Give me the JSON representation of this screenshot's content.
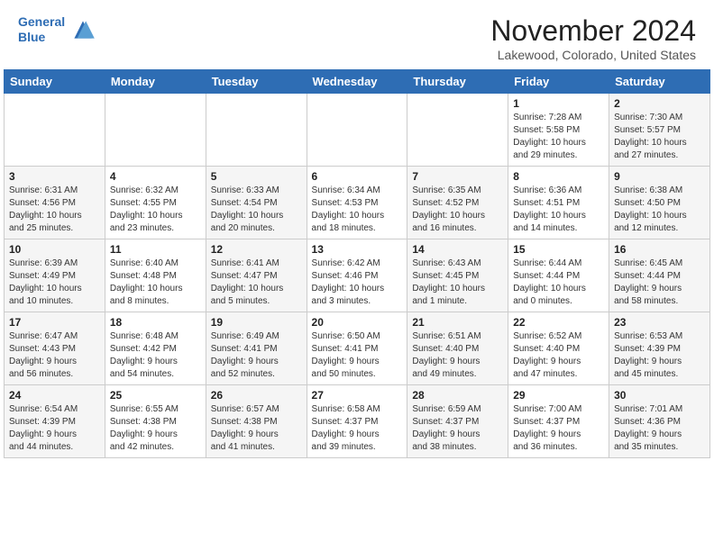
{
  "header": {
    "logo_line1": "General",
    "logo_line2": "Blue",
    "month": "November 2024",
    "location": "Lakewood, Colorado, United States"
  },
  "days_of_week": [
    "Sunday",
    "Monday",
    "Tuesday",
    "Wednesday",
    "Thursday",
    "Friday",
    "Saturday"
  ],
  "weeks": [
    [
      {
        "day": "",
        "info": ""
      },
      {
        "day": "",
        "info": ""
      },
      {
        "day": "",
        "info": ""
      },
      {
        "day": "",
        "info": ""
      },
      {
        "day": "",
        "info": ""
      },
      {
        "day": "1",
        "info": "Sunrise: 7:28 AM\nSunset: 5:58 PM\nDaylight: 10 hours\nand 29 minutes."
      },
      {
        "day": "2",
        "info": "Sunrise: 7:30 AM\nSunset: 5:57 PM\nDaylight: 10 hours\nand 27 minutes."
      }
    ],
    [
      {
        "day": "3",
        "info": "Sunrise: 6:31 AM\nSunset: 4:56 PM\nDaylight: 10 hours\nand 25 minutes."
      },
      {
        "day": "4",
        "info": "Sunrise: 6:32 AM\nSunset: 4:55 PM\nDaylight: 10 hours\nand 23 minutes."
      },
      {
        "day": "5",
        "info": "Sunrise: 6:33 AM\nSunset: 4:54 PM\nDaylight: 10 hours\nand 20 minutes."
      },
      {
        "day": "6",
        "info": "Sunrise: 6:34 AM\nSunset: 4:53 PM\nDaylight: 10 hours\nand 18 minutes."
      },
      {
        "day": "7",
        "info": "Sunrise: 6:35 AM\nSunset: 4:52 PM\nDaylight: 10 hours\nand 16 minutes."
      },
      {
        "day": "8",
        "info": "Sunrise: 6:36 AM\nSunset: 4:51 PM\nDaylight: 10 hours\nand 14 minutes."
      },
      {
        "day": "9",
        "info": "Sunrise: 6:38 AM\nSunset: 4:50 PM\nDaylight: 10 hours\nand 12 minutes."
      }
    ],
    [
      {
        "day": "10",
        "info": "Sunrise: 6:39 AM\nSunset: 4:49 PM\nDaylight: 10 hours\nand 10 minutes."
      },
      {
        "day": "11",
        "info": "Sunrise: 6:40 AM\nSunset: 4:48 PM\nDaylight: 10 hours\nand 8 minutes."
      },
      {
        "day": "12",
        "info": "Sunrise: 6:41 AM\nSunset: 4:47 PM\nDaylight: 10 hours\nand 5 minutes."
      },
      {
        "day": "13",
        "info": "Sunrise: 6:42 AM\nSunset: 4:46 PM\nDaylight: 10 hours\nand 3 minutes."
      },
      {
        "day": "14",
        "info": "Sunrise: 6:43 AM\nSunset: 4:45 PM\nDaylight: 10 hours\nand 1 minute."
      },
      {
        "day": "15",
        "info": "Sunrise: 6:44 AM\nSunset: 4:44 PM\nDaylight: 10 hours\nand 0 minutes."
      },
      {
        "day": "16",
        "info": "Sunrise: 6:45 AM\nSunset: 4:44 PM\nDaylight: 9 hours\nand 58 minutes."
      }
    ],
    [
      {
        "day": "17",
        "info": "Sunrise: 6:47 AM\nSunset: 4:43 PM\nDaylight: 9 hours\nand 56 minutes."
      },
      {
        "day": "18",
        "info": "Sunrise: 6:48 AM\nSunset: 4:42 PM\nDaylight: 9 hours\nand 54 minutes."
      },
      {
        "day": "19",
        "info": "Sunrise: 6:49 AM\nSunset: 4:41 PM\nDaylight: 9 hours\nand 52 minutes."
      },
      {
        "day": "20",
        "info": "Sunrise: 6:50 AM\nSunset: 4:41 PM\nDaylight: 9 hours\nand 50 minutes."
      },
      {
        "day": "21",
        "info": "Sunrise: 6:51 AM\nSunset: 4:40 PM\nDaylight: 9 hours\nand 49 minutes."
      },
      {
        "day": "22",
        "info": "Sunrise: 6:52 AM\nSunset: 4:40 PM\nDaylight: 9 hours\nand 47 minutes."
      },
      {
        "day": "23",
        "info": "Sunrise: 6:53 AM\nSunset: 4:39 PM\nDaylight: 9 hours\nand 45 minutes."
      }
    ],
    [
      {
        "day": "24",
        "info": "Sunrise: 6:54 AM\nSunset: 4:39 PM\nDaylight: 9 hours\nand 44 minutes."
      },
      {
        "day": "25",
        "info": "Sunrise: 6:55 AM\nSunset: 4:38 PM\nDaylight: 9 hours\nand 42 minutes."
      },
      {
        "day": "26",
        "info": "Sunrise: 6:57 AM\nSunset: 4:38 PM\nDaylight: 9 hours\nand 41 minutes."
      },
      {
        "day": "27",
        "info": "Sunrise: 6:58 AM\nSunset: 4:37 PM\nDaylight: 9 hours\nand 39 minutes."
      },
      {
        "day": "28",
        "info": "Sunrise: 6:59 AM\nSunset: 4:37 PM\nDaylight: 9 hours\nand 38 minutes."
      },
      {
        "day": "29",
        "info": "Sunrise: 7:00 AM\nSunset: 4:37 PM\nDaylight: 9 hours\nand 36 minutes."
      },
      {
        "day": "30",
        "info": "Sunrise: 7:01 AM\nSunset: 4:36 PM\nDaylight: 9 hours\nand 35 minutes."
      }
    ]
  ]
}
